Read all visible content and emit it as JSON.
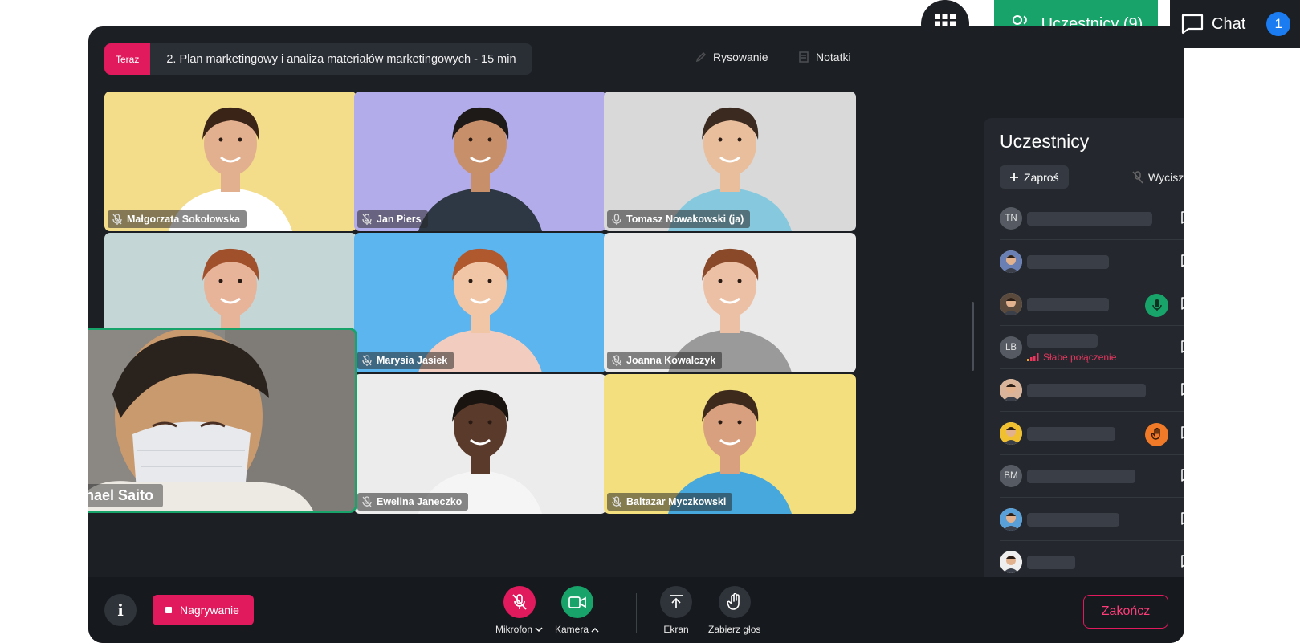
{
  "top_buttons": {
    "participants_label": "Uczestnicy (9)",
    "chat_label": "Chat",
    "chat_count": "1"
  },
  "agenda": {
    "now_label": "Teraz",
    "title": "2. Plan marketingowy i analiza materiałów marketingowych - 15 min"
  },
  "top_tools": {
    "drawing": "Rysowanie",
    "notes": "Notatki"
  },
  "tiles": [
    {
      "name": "Małgorzata Sokołowska",
      "mic": "muted",
      "bg": "#f3dc8a"
    },
    {
      "name": "Jan Piers",
      "mic": "muted",
      "bg": "#b3acea"
    },
    {
      "name": "Tomasz Nowakowski (ja)",
      "mic": "on",
      "bg": "#d9d9d9"
    },
    {
      "name": "",
      "mic": "",
      "bg": "#c5d6d7"
    },
    {
      "name": "Marysia Jasiek",
      "mic": "muted",
      "bg": "#5cb5ef"
    },
    {
      "name": "Joanna Kowalczyk",
      "mic": "muted",
      "bg": "#e9e9e9"
    },
    {
      "name": "Ewelina Janeczko",
      "mic": "muted",
      "bg": "#ececec"
    },
    {
      "name": "Baltazar Myczkowski",
      "mic": "muted",
      "bg": "#f3df7e"
    }
  ],
  "featured": {
    "name": "Michael Saito"
  },
  "panel": {
    "title": "Uczestnicy",
    "invite_label": "Zaproś",
    "mute_all_label": "Wycisz wszystkich",
    "rows": [
      {
        "initials": "TN",
        "mic": "on",
        "badge": "",
        "warning": ""
      },
      {
        "initials": "",
        "mic": "muted",
        "badge": "",
        "warning": ""
      },
      {
        "initials": "",
        "mic": "on",
        "badge": "speaking",
        "warning": ""
      },
      {
        "initials": "LB",
        "mic": "muted",
        "badge": "",
        "warning": "Słabe połączenie"
      },
      {
        "initials": "",
        "mic": "muted",
        "badge": "",
        "warning": ""
      },
      {
        "initials": "",
        "mic": "muted",
        "badge": "hand",
        "warning": ""
      },
      {
        "initials": "BM",
        "mic": "muted",
        "badge": "",
        "warning": ""
      },
      {
        "initials": "",
        "mic": "muted",
        "badge": "",
        "warning": ""
      },
      {
        "initials": "",
        "mic": "muted",
        "badge": "",
        "warning": ""
      }
    ]
  },
  "bottom": {
    "info_label": "i",
    "record_label": "Nagrywanie",
    "mic_label": "Mikrofon",
    "camera_label": "Kamera",
    "screen_label": "Ekran",
    "raise_hand_label": "Zabierz głos",
    "end_label": "Zakończ"
  },
  "colors": {
    "accent_green": "#18a36a",
    "accent_pink": "#e01a5c",
    "chat_badge": "#1a7cf0",
    "hand_badge": "#f07a28",
    "warning": "#e8365e"
  }
}
